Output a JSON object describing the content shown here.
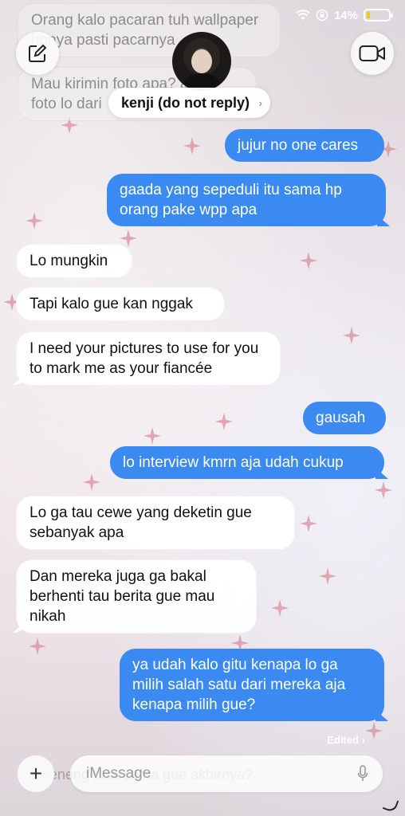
{
  "status": {
    "battery_percent": "14%",
    "wifi_icon": "wifi-icon",
    "lock_icon": "orientation-lock-icon"
  },
  "header": {
    "contact_name": "kenji (do not reply)",
    "contact_chevron": "›",
    "compose_icon": "compose-icon",
    "video_icon": "video-camera-icon"
  },
  "messages": [
    {
      "from": "them",
      "text": "Orang kalo pacaran tuh wallpaper hpnya pasti pacarnya",
      "faded": true
    },
    {
      "from": "them",
      "text": "Mau kirimin foto apa? ambil foto lo dari",
      "faded": true
    },
    {
      "from": "me",
      "text": "jujur no one cares"
    },
    {
      "from": "me",
      "text": "gaada yang sepeduli itu sama hp orang pake wpp apa"
    },
    {
      "from": "them",
      "text": "Lo mungkin"
    },
    {
      "from": "them",
      "text": "Tapi kalo gue kan nggak"
    },
    {
      "from": "them",
      "text": "I need your pictures to use for you to mark me as your fiancée"
    },
    {
      "from": "me",
      "text": "gausah"
    },
    {
      "from": "me",
      "text": "lo interview kmrn aja udah cukup"
    },
    {
      "from": "them",
      "text": "Lo ga tau cewe yang deketin gue sebanyak apa"
    },
    {
      "from": "them",
      "text": "Dan mereka juga ga bakal berhenti tau berita gue mau nikah"
    },
    {
      "from": "me",
      "text": "ya udah kalo gitu kenapa lo ga milih salah satu dari mereka aja kenapa milih gue?"
    }
  ],
  "edited_label": "Edited ›",
  "composer": {
    "plus_label": "+",
    "placeholder": "iMessage",
    "ghost_text": "...seneng bisa sama gue akhirnya?",
    "mic_icon": "microphone-icon"
  },
  "colors": {
    "outgoing": "#3a8af2",
    "incoming": "#ffffff",
    "star": "#d98d9c"
  }
}
